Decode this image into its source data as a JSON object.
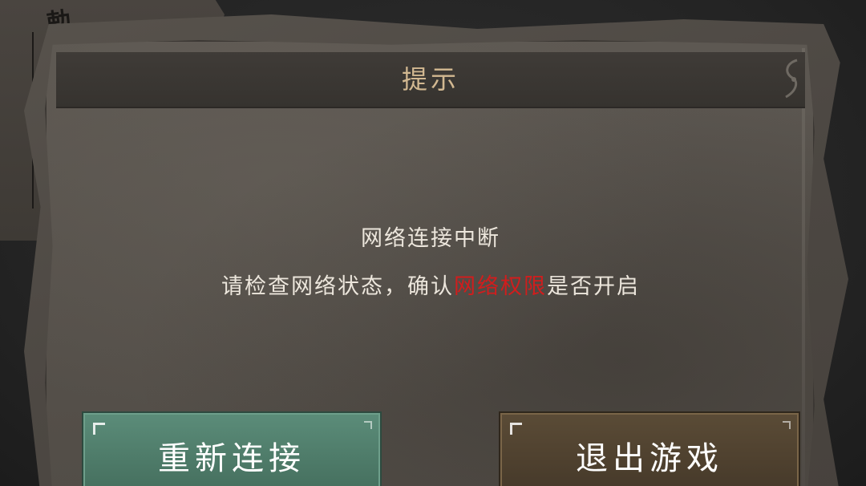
{
  "dialog": {
    "title": "提示",
    "message_line1": "网络连接中断",
    "message_line2_before": "请检查网络状态，确认",
    "message_line2_highlight": "网络权限",
    "message_line2_after": "是否开启"
  },
  "buttons": {
    "reconnect_label": "重新连接",
    "exit_label": "退出游戏"
  },
  "background": {
    "paper_ink": "勅"
  },
  "colors": {
    "title_text": "#d2b891",
    "message_text": "#ece6dc",
    "highlight": "#d11d1d",
    "reconnect_button": "#4e7b69",
    "exit_button": "#4f412f"
  }
}
